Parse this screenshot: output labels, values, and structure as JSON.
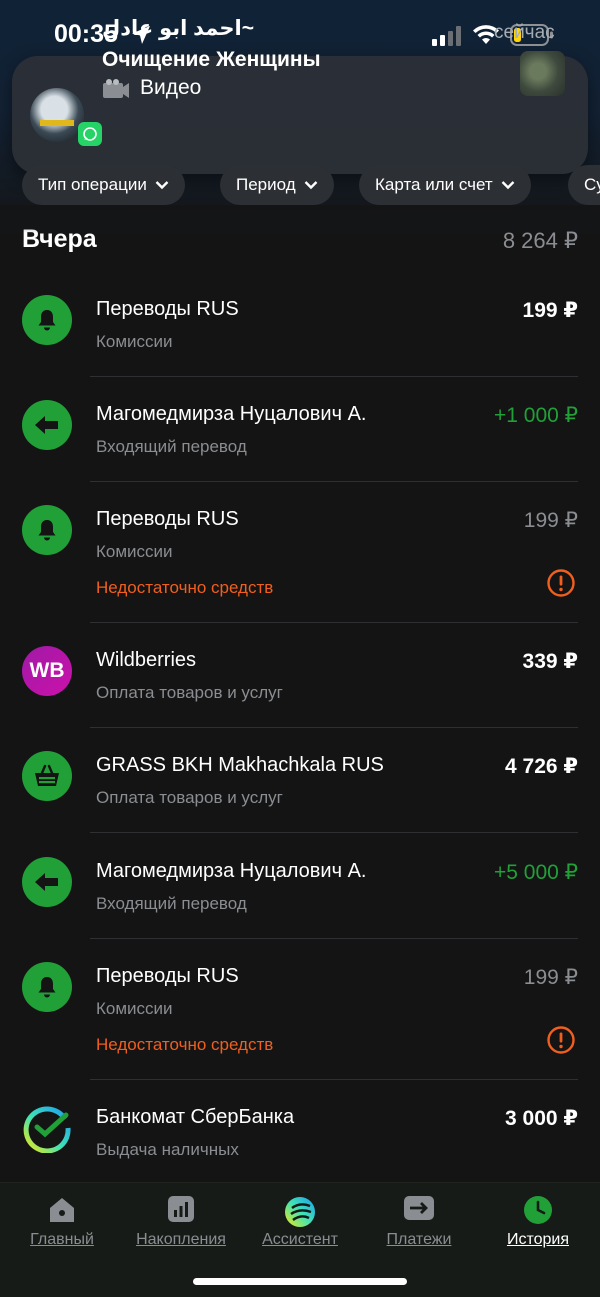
{
  "status_bar": {
    "time": "00:35"
  },
  "notification": {
    "sender": "~احمد ابو عادل",
    "title": "Очищение Женщины",
    "body": "Видео",
    "time": "сейчас",
    "app_icon": "whatsapp-icon"
  },
  "filters": {
    "operation_type": "Тип операции",
    "period": "Период",
    "card_or_account": "Карта или счет",
    "sum_partial": "Су"
  },
  "section": {
    "title": "Вчера",
    "total": "8 264 ₽"
  },
  "operations": [
    {
      "name": "Переводы RUS",
      "category": "Комиссии",
      "amount": "199 ₽",
      "icon": "bell-icon",
      "status": "normal"
    },
    {
      "name": "Магомедмирза Нуцалович А.",
      "category": "Входящий перевод",
      "amount": "+1 000 ₽",
      "icon": "arrow-left-icon",
      "status": "income"
    },
    {
      "name": "Переводы RUS",
      "category": "Комиссии",
      "amount": "199 ₽",
      "icon": "bell-icon",
      "status": "failed",
      "error": "Недостаточно средств"
    },
    {
      "name": "Wildberries",
      "category": "Оплата товаров и услуг",
      "amount": "339 ₽",
      "icon": "wb-logo",
      "logo_text": "WB",
      "status": "normal"
    },
    {
      "name": "GRASS BKH Makhachkala RUS",
      "category": "Оплата товаров и услуг",
      "amount": "4 726 ₽",
      "icon": "basket-icon",
      "status": "normal"
    },
    {
      "name": "Магомедмирза Нуцалович А.",
      "category": "Входящий перевод",
      "amount": "+5 000 ₽",
      "icon": "arrow-left-icon",
      "status": "income"
    },
    {
      "name": "Переводы RUS",
      "category": "Комиссии",
      "amount": "199 ₽",
      "icon": "bell-icon",
      "status": "failed",
      "error": "Недостаточно средств"
    },
    {
      "name": "Банкомат СберБанка",
      "category": "Выдача наличных",
      "amount": "3 000 ₽",
      "icon": "sber-logo",
      "status": "normal"
    }
  ],
  "bottom_nav": {
    "items": [
      {
        "label": "Главный",
        "icon": "home-icon"
      },
      {
        "label": "Накопления",
        "icon": "chart-icon"
      },
      {
        "label": "Ассистент",
        "icon": "assistant-icon"
      },
      {
        "label": "Платежи",
        "icon": "transfer-icon"
      },
      {
        "label": "История",
        "icon": "clock-icon"
      }
    ],
    "active": "История"
  },
  "colors": {
    "accent_green": "#21a038",
    "error_orange": "#f05f1e",
    "muted_text": "#8a8d91",
    "background": "#141414"
  }
}
